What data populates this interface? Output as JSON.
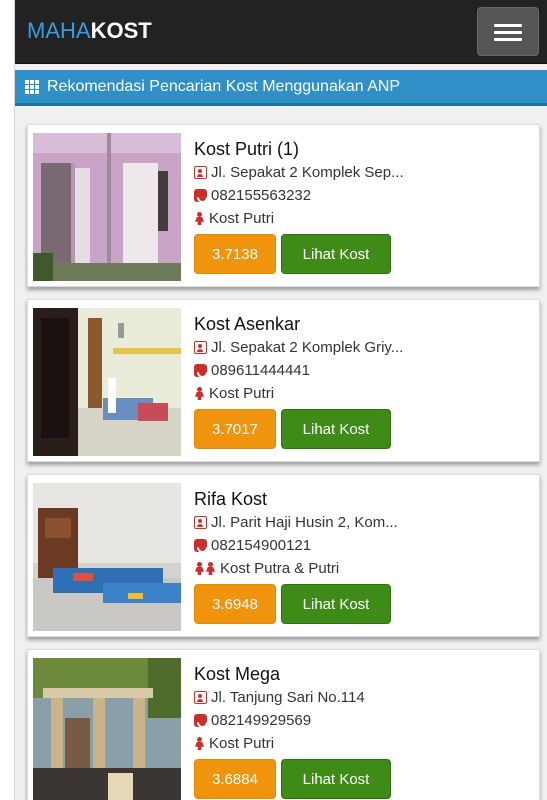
{
  "navbar": {
    "brand_part1": "MAHA",
    "brand_part2": "KOST",
    "toggle_icon": "hamburger-menu-icon"
  },
  "section": {
    "icon": "grid-icon",
    "title": "Rekomendasi Pencarian Kost Menggunakan ANP"
  },
  "colors": {
    "navbar": "#222222",
    "brand_blue": "#3b9ae1",
    "section_bar": "#2f8fc6",
    "score_badge": "#f0940e",
    "view_button": "#3e8c17",
    "icon_red": "#c9302c"
  },
  "listings": [
    {
      "name": "Kost Putri (1)",
      "address": "Jl. Sepakat 2 Komplek Sep...",
      "phone": "082155563232",
      "type": "Kost Putri",
      "score": "3.7138",
      "button": "Lihat Kost"
    },
    {
      "name": "Kost Asenkar",
      "address": "Jl. Sepakat 2 Komplek Griy...",
      "phone": "089611444441",
      "type": "Kost Putri",
      "score": "3.7017",
      "button": "Lihat Kost"
    },
    {
      "name": "Rifa Kost",
      "address": "Jl. Parit Haji Husin 2, Kom...",
      "phone": "082154900121",
      "type": "Kost Putra & Putri",
      "score": "3.6948",
      "button": "Lihat Kost"
    },
    {
      "name": "Kost Mega",
      "address": "Jl. Tanjung Sari No.114",
      "phone": "082149929569",
      "type": "Kost Putri",
      "score": "3.6884",
      "button": "Lihat Kost"
    }
  ]
}
